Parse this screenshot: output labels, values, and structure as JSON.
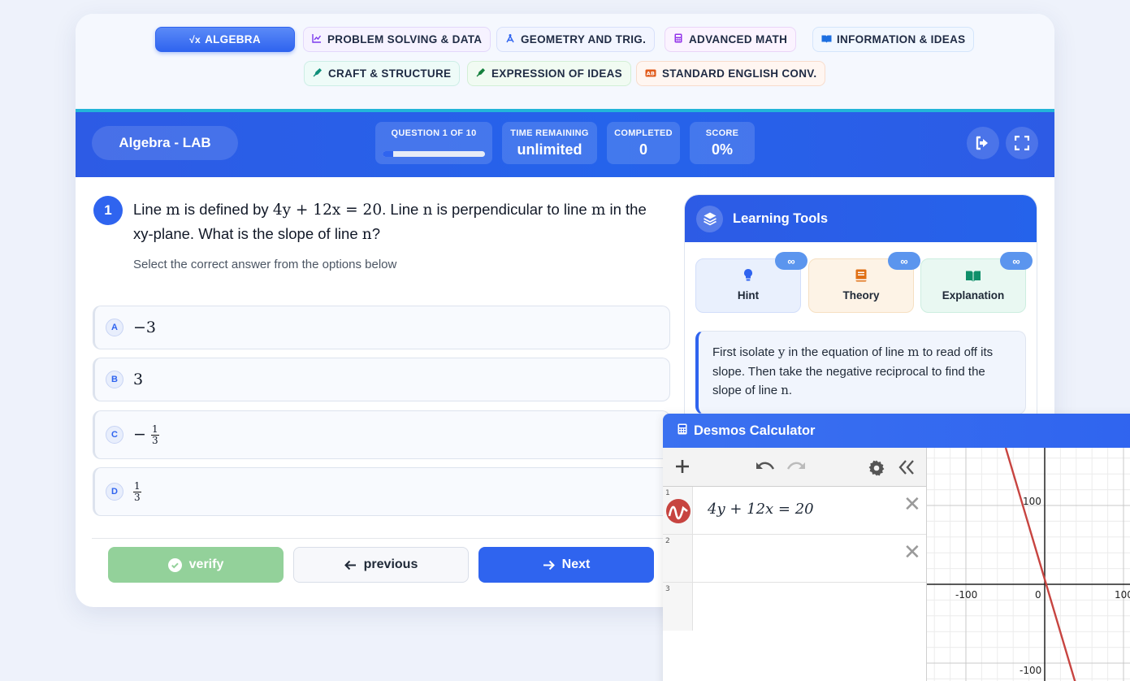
{
  "tabs": [
    {
      "label": "ALGEBRA",
      "icon": "sqrt-icon",
      "active": true
    },
    {
      "label": "PROBLEM SOLVING & DATA",
      "icon": "chart-line-icon"
    },
    {
      "label": "GEOMETRY AND TRIG.",
      "icon": "compass-icon"
    },
    {
      "label": "ADVANCED MATH",
      "icon": "calculator-icon"
    },
    {
      "label": "INFORMATION & IDEAS",
      "icon": "book-open-icon"
    },
    {
      "label": "CRAFT & STRUCTURE",
      "icon": "pen-nib-icon"
    },
    {
      "label": "EXPRESSION OF IDEAS",
      "icon": "pen-nib-icon"
    },
    {
      "label": "STANDARD ENGLISH CONV.",
      "icon": "spell-check-icon"
    }
  ],
  "session": {
    "title": "Algebra - LAB",
    "question_label": "QUESTION 1 OF 10",
    "progress_fraction": 0.1,
    "time_label": "TIME REMAINING",
    "time_value": "unlimited",
    "completed_label": "COMPLETED",
    "completed_value": "0",
    "score_label": "SCORE",
    "score_value": "0%"
  },
  "question": {
    "number": "1",
    "t1": "Line ",
    "m1": "m",
    "t2": " is defined by ",
    "eq": "4y + 12x = 20",
    "t3": ". Line ",
    "m2": "n",
    "t4": " is perpendicular to line ",
    "m3": "m",
    "t5": " in the xy-plane. What is the slope of line ",
    "m4": "n",
    "t6": "?",
    "instruction": "Select the correct answer from the options below"
  },
  "options": [
    {
      "letter": "A",
      "value": "−3"
    },
    {
      "letter": "B",
      "value": "3"
    },
    {
      "letter": "C",
      "sign": "−",
      "num": "1",
      "den": "3"
    },
    {
      "letter": "D",
      "num": "1",
      "den": "3"
    }
  ],
  "buttons": {
    "verify": "verify",
    "previous": "previous",
    "next": "Next"
  },
  "learning_tools": {
    "title": "Learning Tools",
    "tools": [
      {
        "label": "Hint",
        "badge": "∞"
      },
      {
        "label": "Theory",
        "badge": "∞"
      },
      {
        "label": "Explanation",
        "badge": "∞"
      }
    ],
    "hint": {
      "h1": "First isolate ",
      "hv1": "y",
      "h2": " in the equation of line ",
      "hv2": "m",
      "h3": " to read off its slope. Then take the negative reciprocal to find the slope of line ",
      "hv3": "n",
      "h4": "."
    }
  },
  "calculator": {
    "title": "Desmos Calculator",
    "expression": "4y + 12x = 20",
    "rows": [
      "1",
      "2",
      "3"
    ],
    "line_color": "#c74440",
    "axis_ticks": {
      "x_neg": "-100",
      "origin": "0",
      "x_pos": "100",
      "y_pos": "100",
      "y_neg": "-100"
    }
  }
}
